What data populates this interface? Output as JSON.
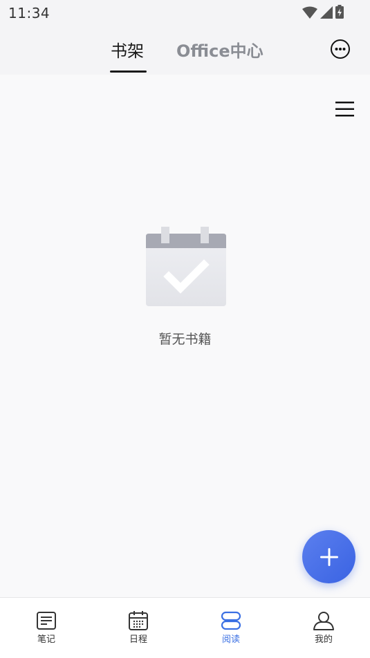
{
  "status_bar": {
    "time": "11:34"
  },
  "header": {
    "tabs": [
      {
        "label": "书架",
        "active": true
      },
      {
        "label": "Office中心",
        "active": false
      }
    ]
  },
  "content": {
    "empty_message": "暂无书籍"
  },
  "bottom_nav": {
    "items": [
      {
        "label": "笔记",
        "icon": "note-icon",
        "active": false
      },
      {
        "label": "日程",
        "icon": "calendar-icon",
        "active": false
      },
      {
        "label": "阅读",
        "icon": "reading-icon",
        "active": true
      },
      {
        "label": "我的",
        "icon": "profile-icon",
        "active": false
      }
    ]
  },
  "colors": {
    "accent": "#3a6fe3",
    "fab": "#4a6fe8",
    "background": "#f9f9fa"
  }
}
